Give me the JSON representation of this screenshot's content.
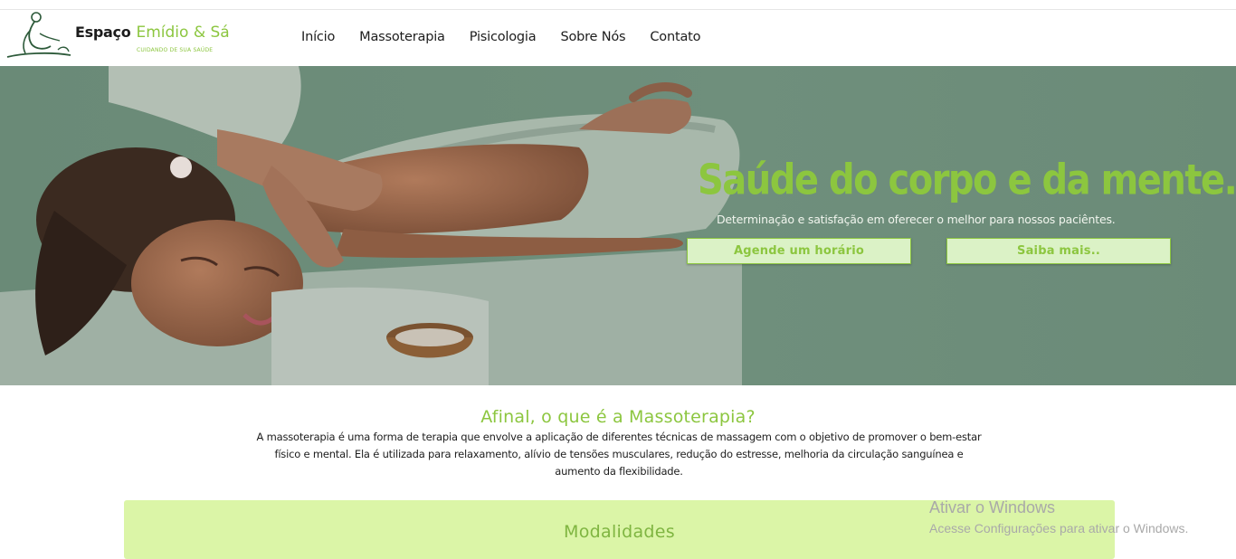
{
  "header": {
    "brand_part1": "Espaço",
    "brand_part2": "Emídio & Sá",
    "tagline": "CUIDANDO DE SUA SAÚDE",
    "logo_icon": "massage-figure-icon",
    "nav": [
      "Início",
      "Massoterapia",
      "Pisicologia",
      "Sobre Nós",
      "Contato"
    ]
  },
  "hero": {
    "title": "Saúde do corpo e da mente.",
    "subtitle": "Determinação e satisfação em oferecer o melhor para nossos paciêntes.",
    "button_schedule": "Agende um horário",
    "button_more": "Saiba mais.."
  },
  "about": {
    "title": "Afinal, o que é a Massoterapia?",
    "text": "A massoterapia é uma forma de terapia que envolve a aplicação de diferentes técnicas de massagem com o objetivo de promover o bem-estar físico e mental. Ela é utilizada para relaxamento, alívio de tensões musculares, redução do estresse, melhoria da circulação sanguínea e aumento da flexibilidade."
  },
  "modalities": {
    "title": "Modalidades"
  },
  "windows_overlay": {
    "title": "Ativar o Windows",
    "subtitle": "Acesse Configurações para ativar o Windows."
  },
  "colors": {
    "accent_green": "#8cc63f",
    "hero_overlay": "#6d8d7a",
    "button_bg": "#dbf2c6",
    "modalities_bg": "#dbf5a7"
  }
}
